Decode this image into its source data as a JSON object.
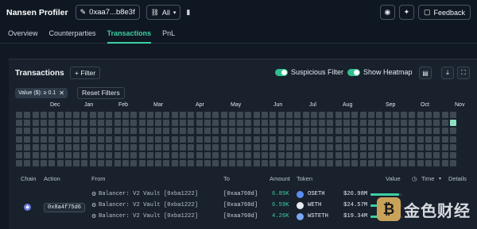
{
  "topbar": {
    "app_title": "Nansen Profiler",
    "address": "0xaa7...b8e3f",
    "chain_filter": "All",
    "feedback_label": "Feedback",
    "icons": [
      "pencil-icon",
      "chain-icon",
      "document-icon",
      "eye-icon",
      "pin-icon",
      "chat-icon"
    ]
  },
  "tabs": [
    {
      "label": "Overview",
      "active": false
    },
    {
      "label": "Counterparties",
      "active": false
    },
    {
      "label": "Transactions",
      "active": true
    },
    {
      "label": "PnL",
      "active": false
    }
  ],
  "panel": {
    "title": "Transactions",
    "filter_button": "+ Filter",
    "suspicious_filter": "Suspicious Filter",
    "show_heatmap": "Show Heatmap",
    "filter_chip": "Value ($): ≥ 0.1",
    "reset_filters": "Reset Filters"
  },
  "heatmap": {
    "months": [
      "Dec",
      "Jan",
      "Feb",
      "Mar",
      "Apr",
      "May",
      "Jun",
      "Jul",
      "Aug",
      "Sep",
      "Oct",
      "Nov"
    ],
    "weeks": 54,
    "days": 7,
    "active_cells": [
      {
        "week": 53,
        "day": 1
      }
    ]
  },
  "table": {
    "columns": [
      "Chain",
      "Action",
      "From",
      "To",
      "Amount",
      "Token",
      "Value",
      "Time",
      "Details"
    ],
    "tx_hash": "0x8a4f75d6",
    "rows": [
      {
        "from": "Balancer: V2 Vault [0xba1222]",
        "to": "[0xaa760d]",
        "amount": "6.85K",
        "token": "OSETH",
        "value": "$26.98M",
        "bar": 0.9
      },
      {
        "from": "Balancer: V2 Vault [0xba1222]",
        "to": "[0xaa760d]",
        "amount": "6.59K",
        "token": "WETH",
        "value": "$24.57M",
        "bar": 0.85
      },
      {
        "from": "Balancer: V2 Vault [0xba1222]",
        "to": "[0xaa760d]",
        "amount": "4.26K",
        "token": "WSTETH",
        "value": "$19.34M",
        "bar": 0.6
      }
    ]
  },
  "watermark": {
    "text": "金色财经"
  },
  "colors": {
    "accent": "#3ecfa3",
    "background": "#111a24",
    "panel": "#18212c",
    "cell": "#3f4953"
  }
}
